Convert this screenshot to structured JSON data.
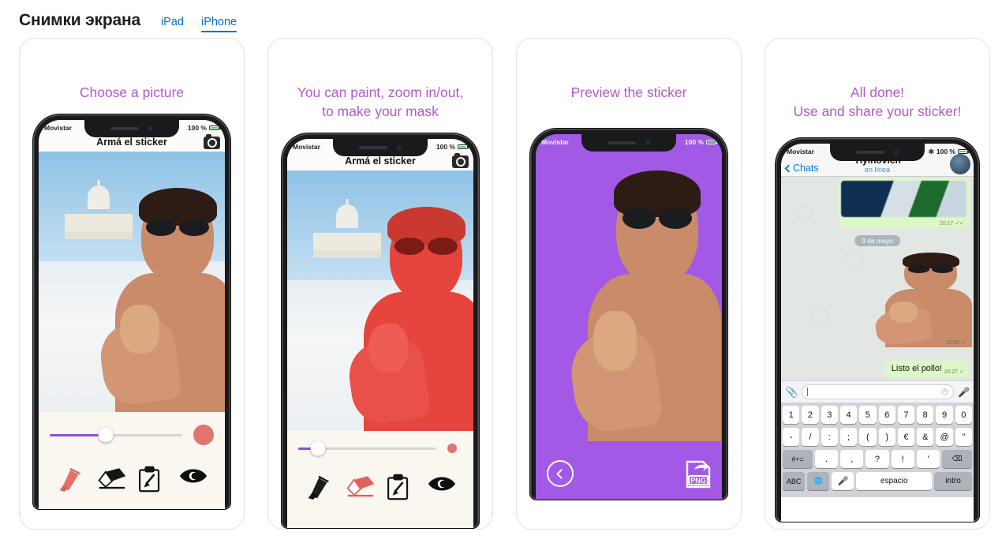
{
  "header": {
    "title": "Снимки экрана",
    "tabs": [
      {
        "label": "iPad",
        "active": false
      },
      {
        "label": "iPhone",
        "active": true
      }
    ],
    "accent_color": "#0070c9"
  },
  "theme": {
    "caption_color": "#b15ac8",
    "purple_bg": "#a259e6",
    "mask_red": "#e52e26",
    "card_border": "#e3e3e3"
  },
  "screenshots": [
    {
      "caption": "Choose a picture",
      "status_bar": {
        "carrier": "Movistar",
        "battery": "100 %"
      },
      "nav_title": "Armá el sticker",
      "camera_icon": "camera-icon",
      "slider_percent": 42,
      "color_dot": "#e2756e",
      "tools": [
        "highlighter-icon",
        "eraser-icon",
        "clipboard-brush-icon",
        "eye-icon"
      ],
      "active_tool": "highlighter-icon"
    },
    {
      "caption": "You can paint, zoom in/out,\nto make your mask",
      "status_bar": {
        "carrier": "Movistar",
        "battery": "100 %"
      },
      "nav_title": "Armá el sticker",
      "camera_icon": "camera-icon",
      "slider_percent": 14,
      "color_dot": "#e2756e",
      "tools": [
        "highlighter-icon",
        "eraser-icon",
        "clipboard-brush-icon",
        "eye-icon"
      ],
      "active_tool": "eraser-icon"
    },
    {
      "caption": "Preview the sticker",
      "status_bar": {
        "carrier": "Movistar",
        "battery": "100 %"
      },
      "back_button": "back-circle-button",
      "export_button": "PNG"
    },
    {
      "caption": "All done!\nUse and share your sticker!",
      "status_bar": {
        "carrier": "Movistar",
        "battery": "100 %",
        "bluetooth": true
      },
      "chat": {
        "back_label": "Chats",
        "contact_name": "Yiyinovich",
        "contact_status": "en línea",
        "date_divider": "3 de mayo",
        "messages": [
          {
            "type": "image",
            "time": "20:17",
            "status": "✓✓"
          },
          {
            "type": "sticker",
            "time": "20:26",
            "status": "✓"
          },
          {
            "type": "text",
            "text": "Listo el pollo!",
            "time": "20:27",
            "status": "✓"
          }
        ],
        "input_placeholder": ""
      },
      "keyboard": {
        "rows": [
          [
            "1",
            "2",
            "3",
            "4",
            "5",
            "6",
            "7",
            "8",
            "9",
            "0"
          ],
          [
            "-",
            "/",
            ":",
            ";",
            "(",
            ")",
            "€",
            "&",
            "@",
            "\""
          ],
          [
            "#+=",
            ".",
            ",",
            "?",
            "!",
            "'",
            "⌫"
          ],
          [
            "ABC",
            "🌐",
            "🎤",
            "espacio",
            "intro"
          ]
        ]
      }
    }
  ]
}
